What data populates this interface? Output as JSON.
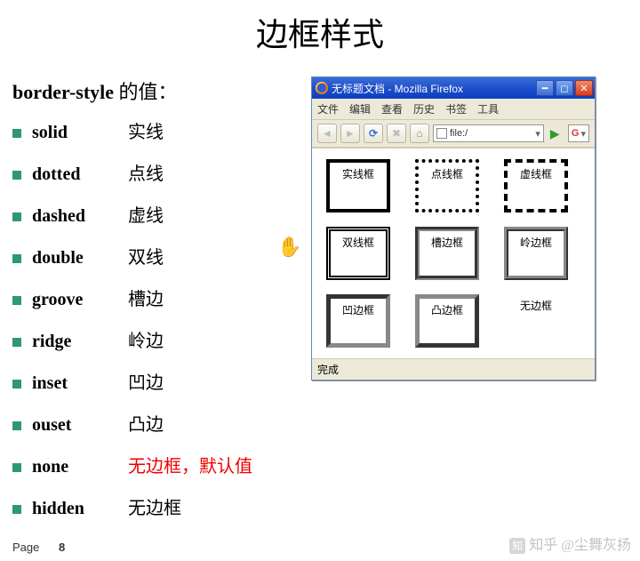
{
  "title": "边框样式",
  "heading_prefix": "border-style",
  "heading_suffix": " 的值：",
  "styles": [
    {
      "name": "solid",
      "desc": "实线",
      "red": false
    },
    {
      "name": "dotted",
      "desc": "点线",
      "red": false
    },
    {
      "name": "dashed",
      "desc": "虚线",
      "red": false
    },
    {
      "name": "double",
      "desc": "双线",
      "red": false
    },
    {
      "name": "groove",
      "desc": "槽边",
      "red": false
    },
    {
      "name": "ridge",
      "desc": "岭边",
      "red": false
    },
    {
      "name": "inset",
      "desc": "凹边",
      "red": false
    },
    {
      "name": "ouset",
      "desc": "凸边",
      "red": false
    },
    {
      "name": "none",
      "desc": "无边框，默认值",
      "red": true
    },
    {
      "name": "hidden",
      "desc": "无边框",
      "red": false
    }
  ],
  "window": {
    "title": "无标题文档 - Mozilla Firefox",
    "menu": [
      "文件",
      "编辑",
      "查看",
      "历史",
      "书签",
      "工具"
    ],
    "address": "file:/",
    "search_engine": "G",
    "status": "完成",
    "boxes": [
      {
        "label": "实线框",
        "cls": "s-solid"
      },
      {
        "label": "点线框",
        "cls": "s-dotted"
      },
      {
        "label": "虚线框",
        "cls": "s-dashed"
      },
      {
        "label": "双线框",
        "cls": "s-double"
      },
      {
        "label": "槽边框",
        "cls": "s-groove"
      },
      {
        "label": "岭边框",
        "cls": "s-ridge"
      },
      {
        "label": "凹边框",
        "cls": "s-inset"
      },
      {
        "label": "凸边框",
        "cls": "s-outset"
      },
      {
        "label": "无边框",
        "cls": "s-none"
      }
    ]
  },
  "cursor_glyph": "✋",
  "footer": {
    "label": "Page",
    "number": "8"
  },
  "watermark": "知乎 @尘舞灰扬"
}
